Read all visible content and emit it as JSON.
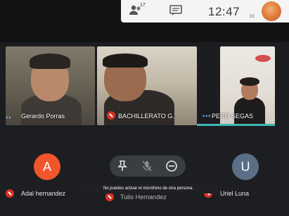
{
  "status_bar": {
    "participants_count": "17",
    "time": "12:47",
    "time_suffix": "10"
  },
  "tiles": [
    {
      "name": "Gerardo Porras",
      "muted": true
    },
    {
      "name": "BACHILLERATO G...",
      "muted": true
    },
    {
      "name": "PERO SEGAS",
      "muted": false
    }
  ],
  "bottom_participants": [
    {
      "initial": "A",
      "name": "Adal hernandez",
      "color": "#f2552c",
      "muted": true
    },
    {
      "initial": "",
      "name": "Tulio Hernandez",
      "muted": true
    },
    {
      "initial": "U",
      "name": "Uriel Luna",
      "color": "#5a6f86",
      "muted": true
    }
  ],
  "toast": {
    "text": "No puedes activar el micrófono de otra persona."
  },
  "colors": {
    "accent": "#3fb7b3",
    "muted": "#d93025",
    "background": "#1b1d20"
  }
}
